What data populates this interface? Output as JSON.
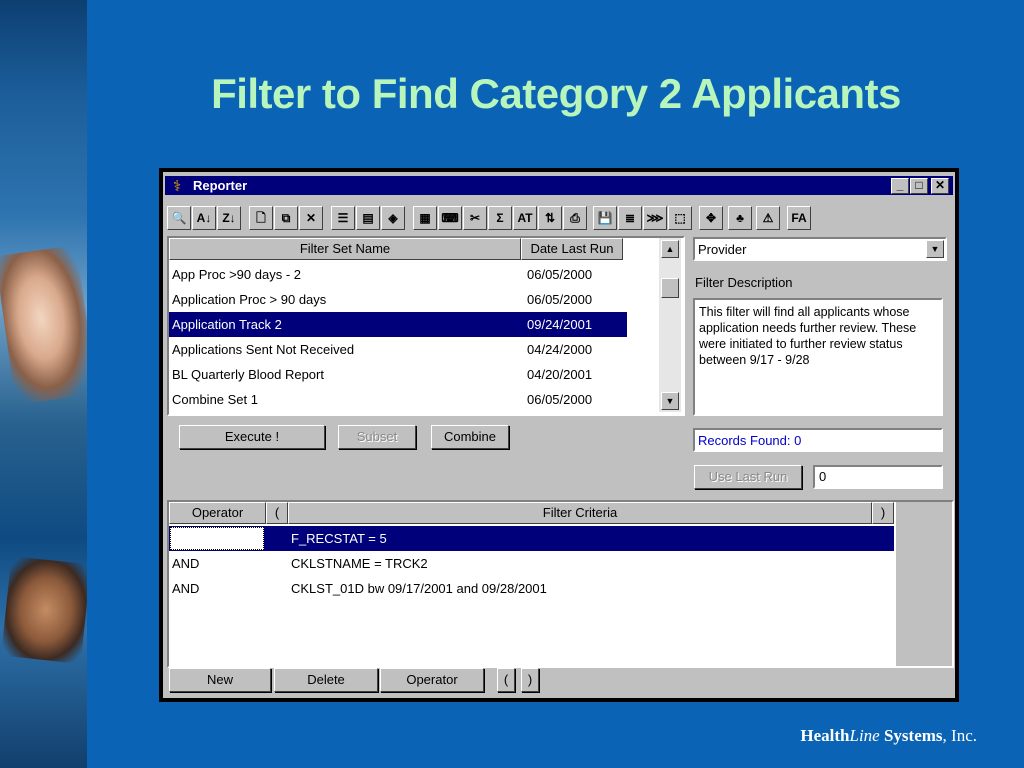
{
  "slide": {
    "title": "Filter to Find Category 2 Applicants",
    "footer": {
      "brand_a": "Health",
      "brand_b": "Line",
      "brand_c": "Systems",
      "brand_d": ", Inc."
    }
  },
  "window": {
    "title": "Reporter",
    "controls": {
      "minimize": "_",
      "maximize": "□",
      "close": "✕"
    }
  },
  "toolbar": {
    "buttons": [
      {
        "name": "binoculars-icon",
        "glyph": "🔍"
      },
      {
        "name": "sort-asc-icon",
        "glyph": "A↓"
      },
      {
        "name": "sort-desc-icon",
        "glyph": "Z↓"
      },
      {
        "name": "new-doc-icon",
        "glyph": "🗋"
      },
      {
        "name": "copy-icon",
        "glyph": "⧉"
      },
      {
        "name": "delete-icon",
        "glyph": "✕"
      },
      {
        "name": "report-icon",
        "glyph": "☰"
      },
      {
        "name": "form-icon",
        "glyph": "▤"
      },
      {
        "name": "chart-icon",
        "glyph": "◈"
      },
      {
        "name": "grid-icon",
        "glyph": "▦"
      },
      {
        "name": "keyboard-icon",
        "glyph": "⌨"
      },
      {
        "name": "scissors-icon",
        "glyph": "✂"
      },
      {
        "name": "sigma-icon",
        "glyph": "Σ"
      },
      {
        "name": "at-icon",
        "glyph": "AT"
      },
      {
        "name": "flow-icon",
        "glyph": "⇅"
      },
      {
        "name": "print-icon",
        "glyph": "⎙"
      },
      {
        "name": "save-icon",
        "glyph": "💾"
      },
      {
        "name": "stack-icon",
        "glyph": "≣"
      },
      {
        "name": "merge-icon",
        "glyph": "⋙"
      },
      {
        "name": "open-icon",
        "glyph": "⬚"
      },
      {
        "name": "navigate-icon",
        "glyph": "✥"
      },
      {
        "name": "tree-icon",
        "glyph": "♣"
      },
      {
        "name": "warning-icon",
        "glyph": "⚠"
      },
      {
        "name": "font-icon",
        "glyph": "FA"
      }
    ]
  },
  "filter_list": {
    "columns": [
      "Filter Set Name",
      "Date Last Run"
    ],
    "rows": [
      {
        "name": "App Proc >90 days - 2",
        "date": "06/05/2000"
      },
      {
        "name": "Application Proc > 90 days",
        "date": "06/05/2000"
      },
      {
        "name": "Application Track 2",
        "date": "09/24/2001"
      },
      {
        "name": "Applications Sent Not Received",
        "date": "04/24/2000"
      },
      {
        "name": "BL Quarterly Blood Report",
        "date": "04/20/2001"
      },
      {
        "name": "Combine Set 1",
        "date": "06/05/2000"
      }
    ],
    "selected_index": 2
  },
  "actions": {
    "execute": "Execute !",
    "subset": "Subset",
    "combine": "Combine"
  },
  "right": {
    "provider_select": "Provider",
    "filter_description_label": "Filter Description",
    "filter_description": "This filter will find all applicants whose application needs further review. These were initiated to further review status between 9/17 - 9/28",
    "records_found": "Records Found: 0",
    "use_last_run": "Use Last Run",
    "last_run_value": "0"
  },
  "criteria": {
    "columns": [
      "Operator",
      "(",
      "Filter Criteria",
      ")"
    ],
    "rows": [
      {
        "op": "",
        "crit": "F_RECSTAT = 5"
      },
      {
        "op": "AND",
        "crit": "CKLSTNAME = TRCK2"
      },
      {
        "op": "AND",
        "crit": "CKLST_01D bw 09/17/2001 and 09/28/2001"
      }
    ],
    "selected_index": 0
  },
  "bottom_buttons": {
    "new": "New",
    "delete": "Delete",
    "operator": "Operator",
    "open_paren": "(",
    "close_paren": ")"
  },
  "colors": {
    "background": "#0a63b5",
    "title": "#b7f5bd",
    "selection": "#00007b",
    "records_text": "#0000c8"
  }
}
